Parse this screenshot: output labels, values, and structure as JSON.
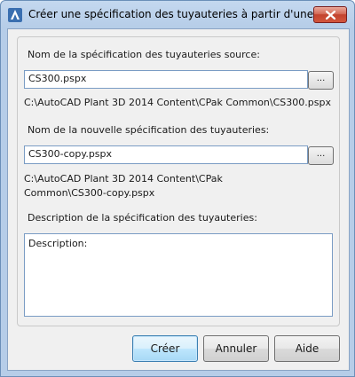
{
  "window": {
    "title": "Créer une spécification des tuyauteries à partir d'une autre",
    "app_icon": "autocad-a-icon",
    "close_icon": "close-icon"
  },
  "source": {
    "label": "Nom de la spécification des tuyauteries source:",
    "value": "CS300.pspx",
    "browse_label": "...",
    "path": "C:\\AutoCAD Plant 3D 2014 Content\\CPak Common\\CS300.pspx"
  },
  "new_spec": {
    "label": "Nom de la nouvelle spécification des tuyauteries:",
    "value": "CS300-copy.pspx",
    "browse_label": "...",
    "path": "C:\\AutoCAD Plant 3D 2014 Content\\CPak Common\\CS300-copy.pspx"
  },
  "description": {
    "label": "Description de la spécification des tuyauteries:",
    "value": "Description:"
  },
  "buttons": {
    "create": "Créer",
    "cancel": "Annuler",
    "help": "Aide"
  },
  "colors": {
    "accent": "#3c7fb1",
    "close": "#c2432e"
  }
}
